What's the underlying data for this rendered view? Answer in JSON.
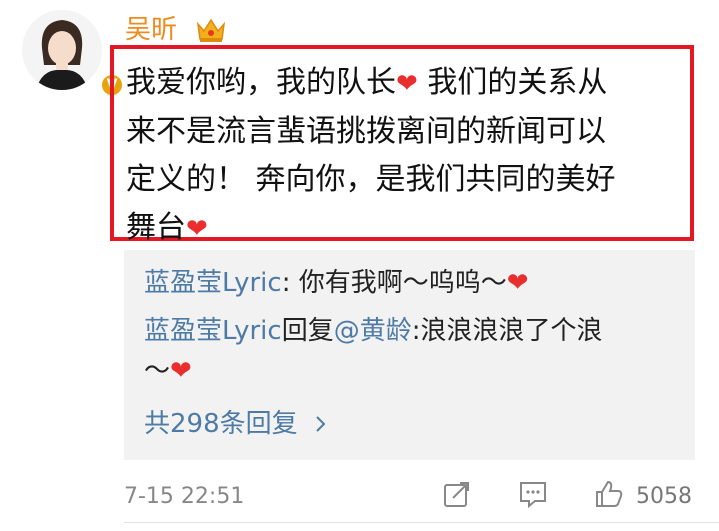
{
  "user": {
    "name": "吴昕"
  },
  "post": {
    "line1": "我爱你哟，我的队长",
    "line1_rest": " 我们的关系从",
    "line2": "来不是流言蜚语挑拨离间的新闻可以",
    "line3": "定义的！ 奔向你，是我们共同的美好",
    "line4": "舞台"
  },
  "replies": [
    {
      "author": "蓝盈莹Lyric",
      "sep": ": ",
      "text": "你有我啊～呜呜～"
    },
    {
      "author": "蓝盈莹Lyric",
      "reply_label": "回复",
      "mention": "@黄龄",
      "text": ":浪浪浪浪了个浪",
      "text2": "～"
    }
  ],
  "reply_total": "共298条回复",
  "footer": {
    "time": "7-15 22:51",
    "likes": "5058"
  },
  "colors": {
    "accent": "#f08a1c",
    "highlight": "#e31825",
    "link": "#4e7ba5",
    "heart": "#ea2e2e"
  },
  "icons": [
    "crown-icon",
    "verified-badge-icon",
    "heart-emoji",
    "chevron-right-icon",
    "share-icon",
    "comment-icon",
    "like-icon"
  ]
}
